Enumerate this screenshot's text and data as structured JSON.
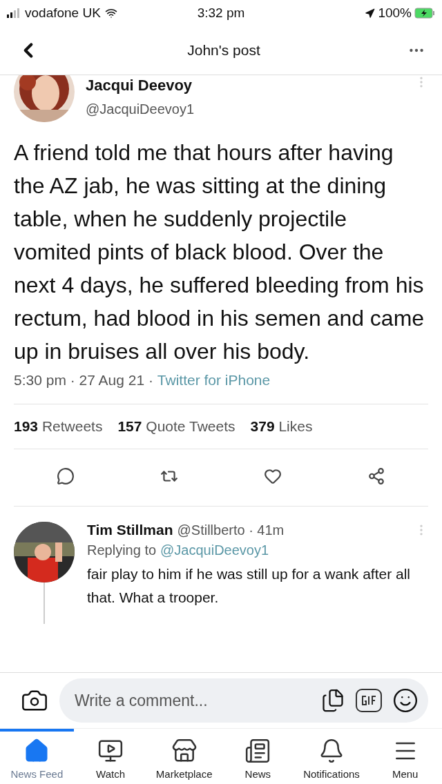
{
  "status_bar": {
    "carrier": "vodafone UK",
    "time": "3:32 pm",
    "battery": "100%"
  },
  "nav": {
    "title": "John's post"
  },
  "tweet": {
    "name": "Jacqui Deevoy",
    "handle": "@JacquiDeevoy1",
    "text": "A friend told me that hours after having the AZ jab, he was sitting at the dining table, when he suddenly projectile vomited pints of black blood. Over the next 4 days, he suffered bleeding from his rectum, had blood in his semen and came up in bruises all over his body.",
    "time": "5:30 pm · 27 Aug 21 · ",
    "source": "Twitter for iPhone",
    "stats": [
      {
        "count": "193",
        "label": "Retweets"
      },
      {
        "count": "157",
        "label": "Quote Tweets"
      },
      {
        "count": "379",
        "label": "Likes"
      }
    ]
  },
  "reply": {
    "name": "Tim Stillman",
    "handle": "@Stillberto · 41m",
    "replying_to": "Replying to ",
    "mention": "@JacquiDeevoy1",
    "text": "fair play to him if he was still up for a wank after all that. What a trooper."
  },
  "comment_bar": {
    "placeholder": "Write a comment..."
  },
  "tab_bar": [
    {
      "label": "News Feed",
      "selected": true
    },
    {
      "label": "Watch",
      "selected": false
    },
    {
      "label": "Marketplace",
      "selected": false
    },
    {
      "label": "News",
      "selected": false
    },
    {
      "label": "Notifications",
      "selected": false
    },
    {
      "label": "Menu",
      "selected": false
    }
  ]
}
